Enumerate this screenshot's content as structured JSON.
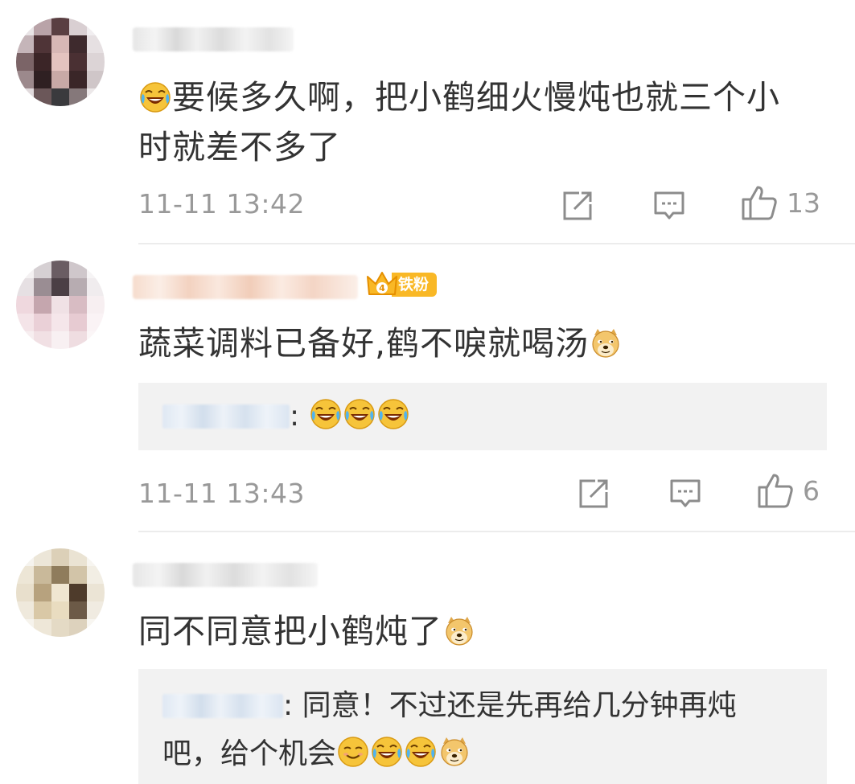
{
  "comments": [
    {
      "text": "要候多久啊，把小鹤细火慢炖也就三个小时就差不多了",
      "line1": "要候多久啊，把小鹤细火慢炖也就三个小",
      "line2": "时就差不多了",
      "time": "11-11 13:42",
      "likes": "13"
    },
    {
      "badge": "铁粉",
      "text": "蔬菜调料已备好,鹤不唳就喝汤",
      "reply": {
        "text": ":"
      },
      "time": "11-11 13:43",
      "likes": "6"
    },
    {
      "text": "同不同意把小鹤炖了",
      "reply": {
        "text": ": 同意！不过还是先再给几分钟再炖吧，给个机会",
        "line1": ": 同意！不过还是先再给几分钟再炖",
        "line2": "吧，给个机会"
      }
    }
  ],
  "icons": {
    "repost": "repost-icon",
    "comment": "comment-icon",
    "like": "thumbs-up-icon",
    "laugh_cry_emoji": "laugh-cry-emoji",
    "doge_emoji": "doge-emoji",
    "smile_emoji": "smile-emoji",
    "fan_badge": "crown-icon"
  },
  "colors": {
    "text": "#333333",
    "meta": "#999999",
    "reply_bg": "#f2f2f2",
    "badge_bg": "#f9b826"
  }
}
